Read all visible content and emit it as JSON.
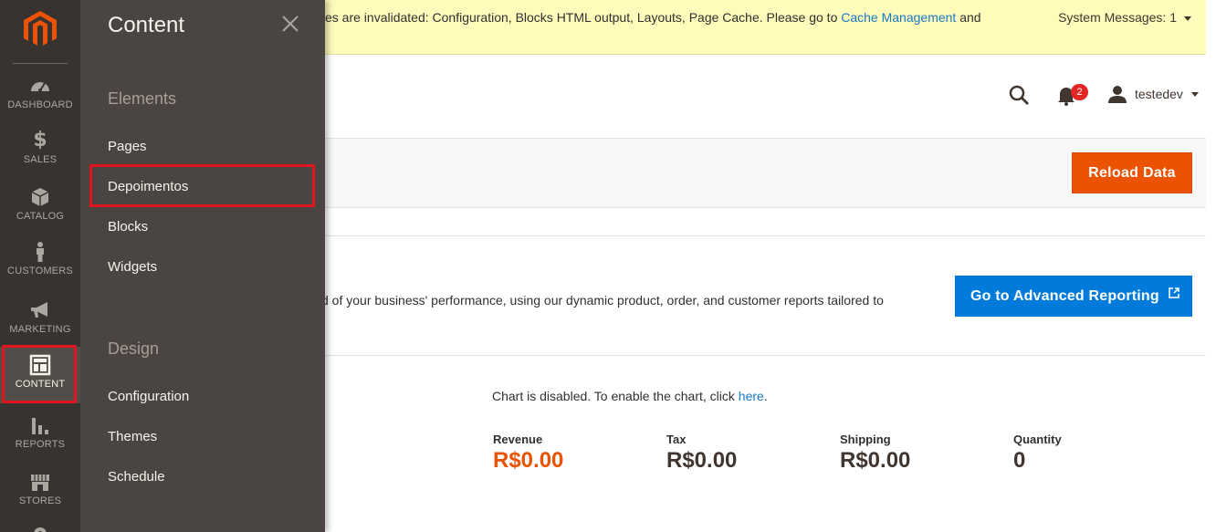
{
  "nav": {
    "items": [
      {
        "label": "DASHBOARD",
        "icon": "dashboard-icon"
      },
      {
        "label": "SALES",
        "icon": "dollar-icon"
      },
      {
        "label": "CATALOG",
        "icon": "box-icon"
      },
      {
        "label": "CUSTOMERS",
        "icon": "person-icon"
      },
      {
        "label": "MARKETING",
        "icon": "megaphone-icon"
      },
      {
        "label": "CONTENT",
        "icon": "layout-icon"
      },
      {
        "label": "REPORTS",
        "icon": "bar-chart-icon"
      },
      {
        "label": "STORES",
        "icon": "storefront-icon"
      }
    ],
    "active": "CONTENT"
  },
  "flyout": {
    "title": "Content",
    "sections": [
      {
        "title": "Elements",
        "links": [
          "Pages",
          "Depoimentos",
          "Blocks",
          "Widgets"
        ]
      },
      {
        "title": "Design",
        "links": [
          "Configuration",
          "Themes",
          "Schedule"
        ]
      }
    ]
  },
  "system_message": {
    "text_before": "es are invalidated: Configuration, Blocks HTML output, Layouts, Page Cache. Please go to ",
    "link": "Cache Management",
    "text_after": " and",
    "count_label": "System Messages: 1"
  },
  "header": {
    "notifications_count": "2",
    "username": "testedev"
  },
  "actions": {
    "reload_label": "Reload Data"
  },
  "advanced_reporting": {
    "text": "d of your business' performance, using our dynamic product, order, and customer reports tailored to",
    "button_label": "Go to Advanced Reporting"
  },
  "chart": {
    "message_before": "Chart is disabled. To enable the chart, click ",
    "link": "here",
    "message_after": "."
  },
  "totals": [
    {
      "label": "Revenue",
      "value": "R$0.00"
    },
    {
      "label": "Tax",
      "value": "R$0.00"
    },
    {
      "label": "Shipping",
      "value": "R$0.00"
    },
    {
      "label": "Quantity",
      "value": "0"
    }
  ],
  "colors": {
    "nav_bg": "#373330",
    "flyout_bg": "#4a4542",
    "accent_orange": "#eb5202",
    "accent_blue": "#007bdb",
    "highlight_red": "#e2151f",
    "sysbar_bg": "#fffbbb"
  }
}
